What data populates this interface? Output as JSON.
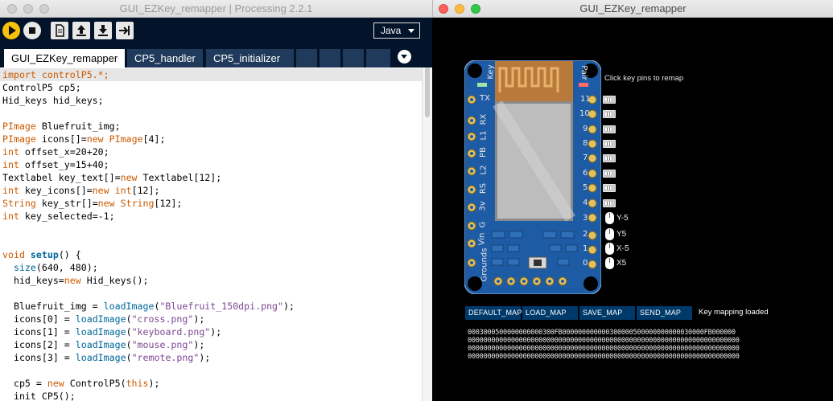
{
  "ide": {
    "window_title": "GUI_EZKey_remapper | Processing 2.2.1",
    "mode": "Java",
    "tabs": [
      "GUI_EZKey_remapper",
      "CP5_handler",
      "CP5_initializer"
    ],
    "toolbar_icons": [
      "run-icon",
      "stop-icon",
      "new-icon",
      "open-icon",
      "save-icon",
      "export-icon"
    ],
    "code": {
      "l1": "import controlP5.*;",
      "l2": "ControlP5 cp5;",
      "l3": "Hid_keys hid_keys;",
      "l4a": "PImage",
      "l4b": " Bluefruit_img;",
      "l5a": "PImage",
      "l5b": " icons[]=",
      "l5c": "new",
      "l5d": " ",
      "l5e": "PImage",
      "l5f": "[4];",
      "l6a": "int",
      "l6b": " offset_x=20+20;",
      "l7a": "int",
      "l7b": " offset_y=15+40;",
      "l8a": "Textlabel key_text[]=",
      "l8b": "new",
      "l8c": " Textlabel[12];",
      "l9a": "int",
      "l9b": " key_icons[]=",
      "l9c": "new",
      "l9d": " ",
      "l9e": "int",
      "l9f": "[12];",
      "l10a": "String",
      "l10b": " key_str[]=",
      "l10c": "new",
      "l10d": " ",
      "l10e": "String",
      "l10f": "[12];",
      "l11a": "int",
      "l11b": " key_selected=-1;",
      "l12a": "void",
      "l12b": " ",
      "l12c": "setup",
      "l12d": "() {",
      "l13a": "  ",
      "l13b": "size",
      "l13c": "(640, 480);",
      "l14a": "  hid_keys=",
      "l14b": "new",
      "l14c": " Hid_keys();",
      "l15a": "  Bluefruit_img = ",
      "l15b": "loadImage",
      "l15c": "(",
      "l15d": "\"Bluefruit_150dpi.png\"",
      "l15e": ");",
      "l16a": "  icons[0] = ",
      "l16b": "loadImage",
      "l16c": "(",
      "l16d": "\"cross.png\"",
      "l16e": ");",
      "l17a": "  icons[1] = ",
      "l17b": "loadImage",
      "l17c": "(",
      "l17d": "\"keyboard.png\"",
      "l17e": ");",
      "l18a": "  icons[2] = ",
      "l18b": "loadImage",
      "l18c": "(",
      "l18d": "\"mouse.png\"",
      "l18e": ");",
      "l19a": "  icons[3] = ",
      "l19b": "loadImage",
      "l19c": "(",
      "l19d": "\"remote.png\"",
      "l19e": ");",
      "l20a": "  cp5 = ",
      "l20b": "new",
      "l20c": " ControlP5(",
      "l20d": "this",
      "l20e": ");",
      "l21": "  init_CP5();"
    }
  },
  "sketch": {
    "window_title": "GUI_EZKey_remapper",
    "hint": "Click key pins to remap",
    "board": {
      "left_labels": [
        "TX",
        "RX",
        "L1",
        "PB",
        "L2",
        "RS",
        "3v",
        "G",
        "Vin",
        "Grounds"
      ],
      "right_pins": [
        "11",
        "10",
        "9",
        "8",
        "7",
        "6",
        "5",
        "4",
        "3",
        "2",
        "1",
        "0"
      ],
      "top_left_label": "Key",
      "top_right_label": "Pair"
    },
    "mouse_labels": [
      "Y-5",
      "Y5",
      "X-5",
      "X5"
    ],
    "buttons": [
      "DEFAULT_MAP",
      "LOAD_MAP",
      "SAVE_MAP",
      "SEND_MAP"
    ],
    "status": "Key mapping loaded",
    "map_lines": [
      "0003000500000000000300FB000000000000300000500000000000030000FB000000",
      "000000000000000000000000000000000000000000000000000000000000000000000",
      "000000000000000000000000000000000000000000000000000000000000000000000",
      "000000000000000000000000000000000000000000000000000000000000000000000"
    ]
  },
  "colors": {
    "toolbar_bg": "#02132a",
    "tab_inactive": "#1f3a5a",
    "keyword": "#cd5a00",
    "function": "#006699",
    "string": "#7d4793",
    "board_blue": "#1d5ba5",
    "run_yellow": "#f6c20c"
  }
}
